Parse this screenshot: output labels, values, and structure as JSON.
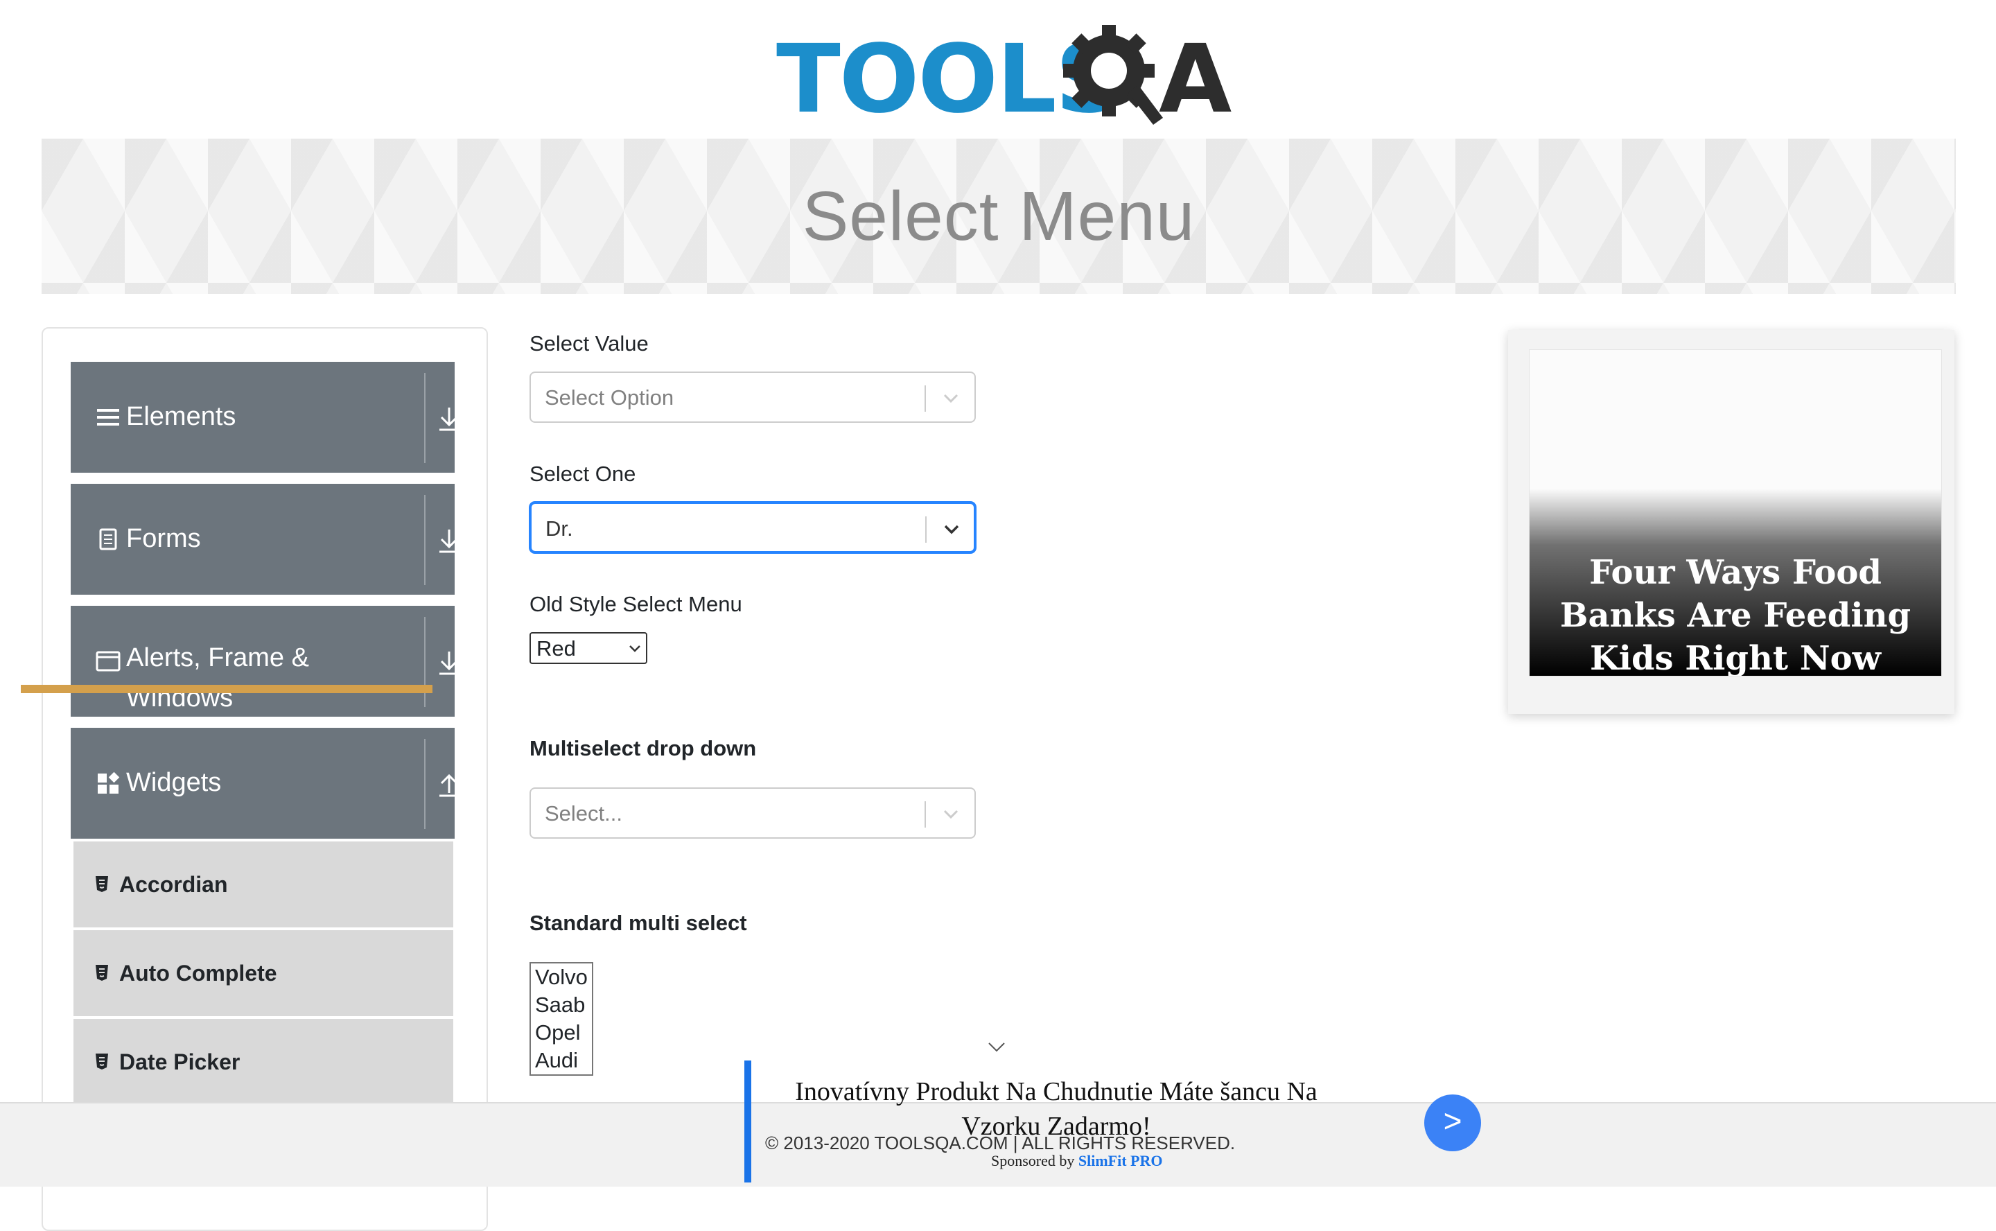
{
  "header": {
    "logo_text_left": "TOOLS",
    "logo_text_right": "A"
  },
  "banner": {
    "title": "Select Menu"
  },
  "sidebar": {
    "groups": [
      {
        "label": "Elements",
        "icon": "hamburger-icon",
        "state": "collapsed"
      },
      {
        "label": "Forms",
        "icon": "document-icon",
        "state": "collapsed"
      },
      {
        "label": "Alerts, Frame & Windows",
        "icon": "window-icon",
        "state": "collapsed"
      },
      {
        "label": "Widgets",
        "icon": "widgets-icon",
        "state": "expanded"
      }
    ],
    "widget_items": [
      {
        "label": "Accordian"
      },
      {
        "label": "Auto Complete"
      },
      {
        "label": "Date Picker"
      }
    ]
  },
  "form": {
    "select_value": {
      "label": "Select Value",
      "placeholder": "Select Option"
    },
    "select_one": {
      "label": "Select One",
      "value": "Dr."
    },
    "old_style": {
      "label": "Old Style Select Menu",
      "value": "Red"
    },
    "multiselect": {
      "label": "Multiselect drop down",
      "placeholder": "Select..."
    },
    "standard_multi": {
      "label": "Standard multi select",
      "options": [
        "Volvo",
        "Saab",
        "Opel",
        "Audi"
      ]
    }
  },
  "ad_right": {
    "headline": "Four Ways Food Banks Are Feeding Kids Right Now",
    "accent_color": "#d4a04c"
  },
  "bottom_ad": {
    "text": "Inovatívny Produkt Na Chudnutie Máte šancu Na Vzorku Zadarmo!",
    "sponsored_prefix": "Sponsored by",
    "sponsor": "SlimFit PRO",
    "button": ">"
  },
  "footer": {
    "copyright": "© 2013-2020 TOOLSQA.COM | ALL RIGHTS RESERVED."
  },
  "colors": {
    "accent": "#2684ff",
    "sidebar_group": "#6c757d",
    "sidebar_item": "#d9d9d9",
    "logo_blue": "#1c8ecb"
  }
}
